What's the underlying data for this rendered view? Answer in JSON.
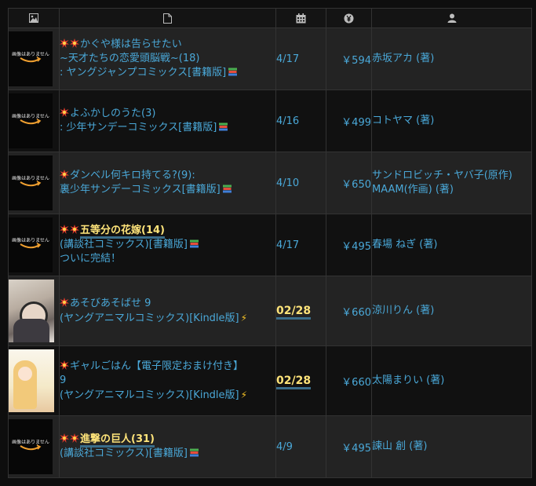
{
  "headers": [
    "image-icon",
    "document-icon",
    "calendar-icon",
    "yen-icon",
    "user-icon"
  ],
  "no_image_text": "画像はありません",
  "rows": [
    {
      "img": "none",
      "burst": 2,
      "title_lines": [
        "かぐや様は告らせたい",
        "~天才たちの恋愛頭脳戦~(18)",
        ": ヤングジャンプコミックス[書籍版]"
      ],
      "highlight": "",
      "suffix": "books",
      "date": "4/17",
      "date_new": false,
      "price": "￥594",
      "author": "赤坂アカ (著)"
    },
    {
      "img": "none",
      "burst": 1,
      "title_lines": [
        "よふかしのうた(3)",
        ": 少年サンデーコミックス[書籍版]"
      ],
      "highlight": "",
      "suffix": "books",
      "date": "4/16",
      "date_new": false,
      "price": "￥499",
      "author": "コトヤマ (著)"
    },
    {
      "img": "none",
      "burst": 1,
      "title_lines": [
        "ダンベル何キロ持てる?(9):",
        "裏少年サンデーコミックス[書籍版]"
      ],
      "highlight": "",
      "suffix": "books",
      "date": "4/10",
      "date_new": false,
      "price": "￥650",
      "author": "サンドロビッチ・ヤバ子(原作)\nMAAM(作画) (著)"
    },
    {
      "img": "none",
      "burst": 2,
      "title_lines": [
        "(講談社コミックス)[書籍版]",
        "ついに完結！"
      ],
      "highlight": "五等分の花嫁(14)",
      "suffix": "books",
      "date": "4/17",
      "date_new": false,
      "price": "￥495",
      "author": "春場 ねぎ (著)"
    },
    {
      "img": "cover1",
      "burst": 1,
      "title_lines": [
        "あそびあそばせ 9",
        "(ヤングアニマルコミックス)[Kindle版]"
      ],
      "highlight": "",
      "suffix": "bolt",
      "date": "02/28",
      "date_new": true,
      "price": "￥660",
      "author": "涼川りん (著)"
    },
    {
      "img": "cover2",
      "burst": 1,
      "title_lines": [
        "ギャルごはん【電子限定おまけ付き】",
        "9",
        "(ヤングアニマルコミックス)[Kindle版]"
      ],
      "highlight": "",
      "suffix": "bolt",
      "date": "02/28",
      "date_new": true,
      "price": "￥660",
      "author": "太陽まりい (著)"
    },
    {
      "img": "none",
      "burst": 2,
      "title_lines": [
        "(講談社コミックス)[書籍版]"
      ],
      "highlight": "進撃の巨人(31)",
      "suffix": "books",
      "date": "4/9",
      "date_new": false,
      "price": "￥495",
      "author": "諫山 創 (著)"
    }
  ]
}
